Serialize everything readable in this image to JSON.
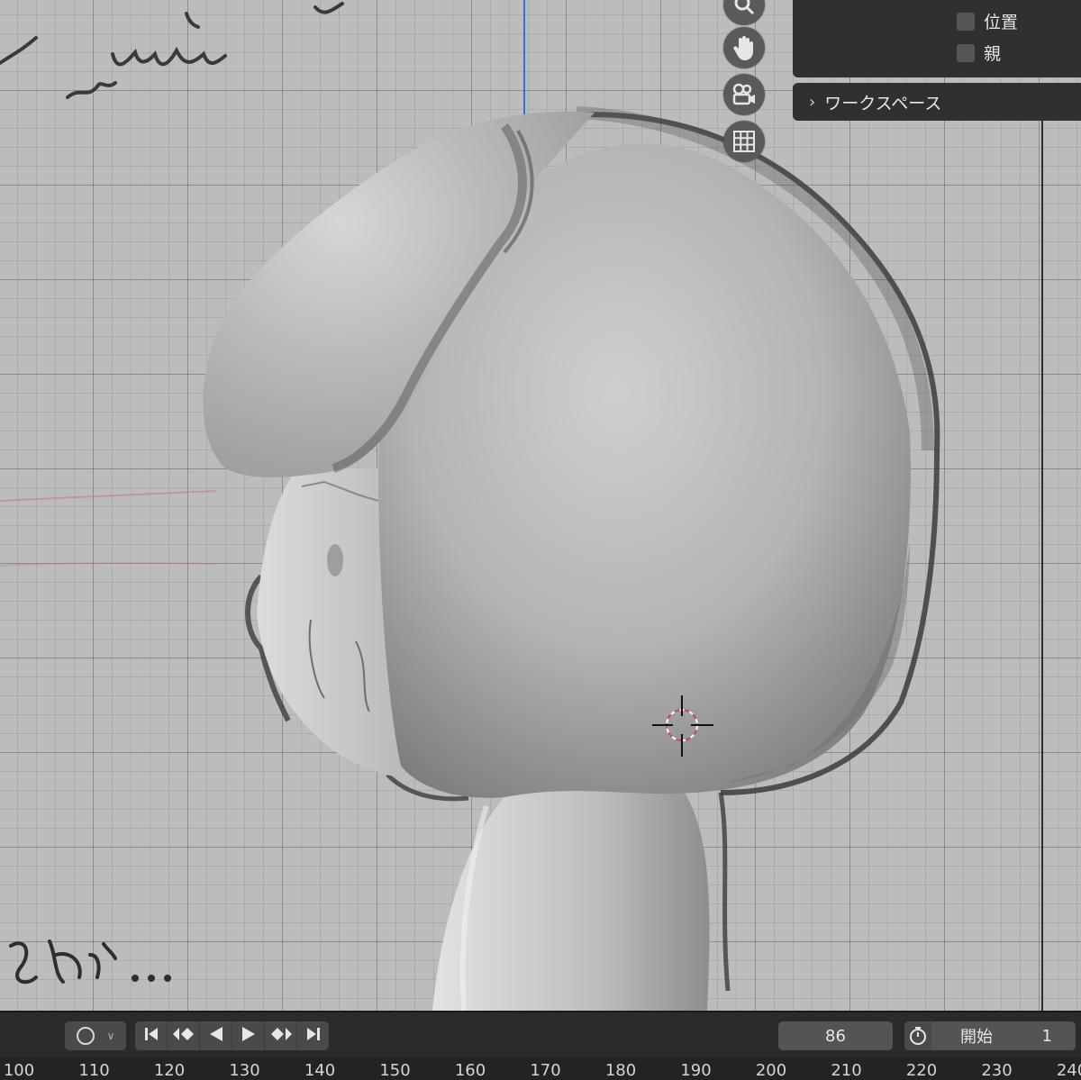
{
  "nav_icons": [
    "zoom-icon",
    "hand-pan-icon",
    "camera-icon",
    "grid-icon"
  ],
  "properties_panel": {
    "checkboxes": [
      {
        "label": "位置",
        "checked": false
      },
      {
        "label": "親",
        "checked": false
      }
    ]
  },
  "workspace_panel": {
    "label": "ワークスペース"
  },
  "timeline": {
    "current_frame": "86",
    "start_label": "開始",
    "start_value": "1",
    "ruler_ticks": [
      "100",
      "110",
      "120",
      "130",
      "140",
      "150",
      "160",
      "170",
      "180",
      "190",
      "200",
      "210",
      "220",
      "230",
      "240"
    ]
  },
  "colors": {
    "panel_bg": "#303030",
    "viewport_bg": "#bcbcbc",
    "timeline_bg": "#2b2b2b",
    "cursor_red": "#d8404a",
    "axis_blue": "#3a6fd8"
  }
}
